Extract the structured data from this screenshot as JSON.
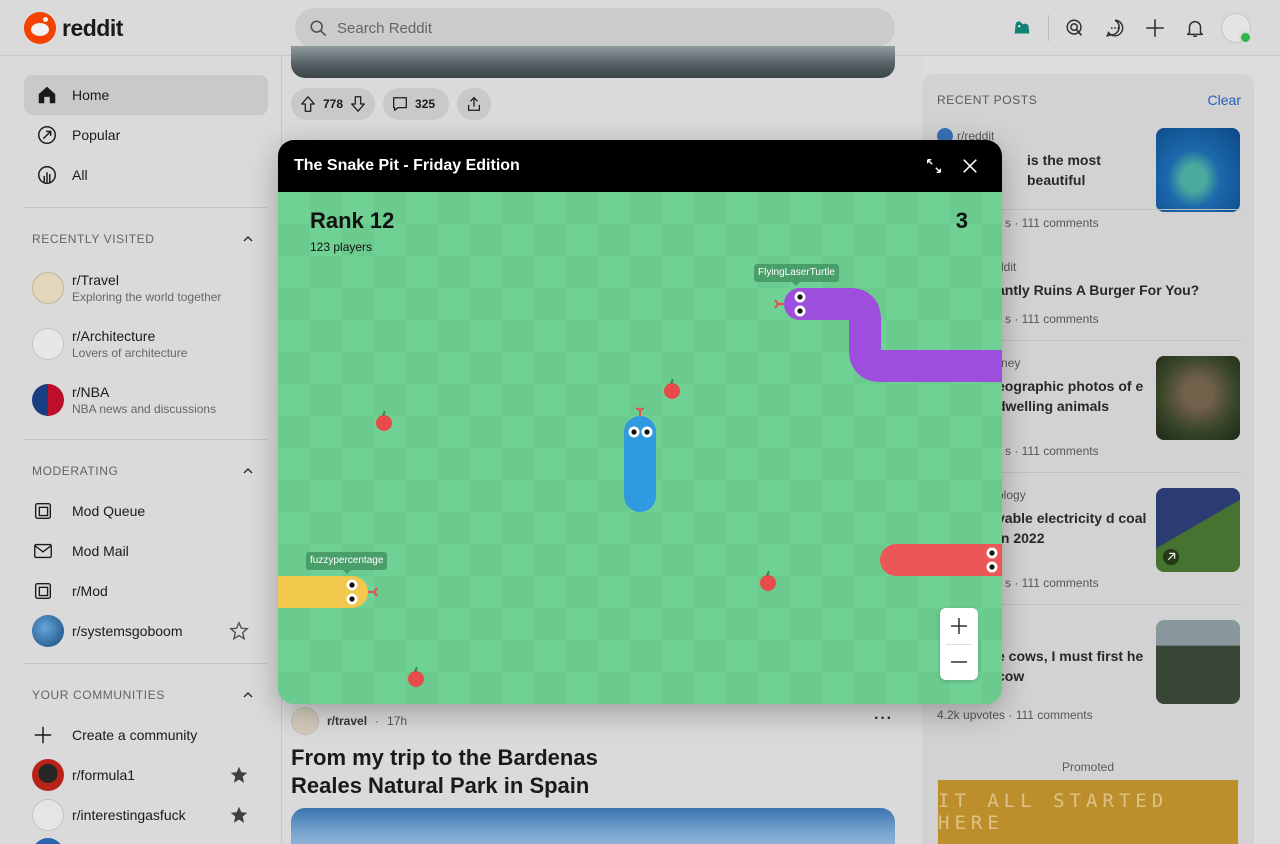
{
  "header": {
    "logo_text": "reddit",
    "search_placeholder": "Search Reddit",
    "icons": [
      "game-icon",
      "ads-icon",
      "chat-icon",
      "create-icon",
      "notifications-icon",
      "avatar"
    ]
  },
  "sidebar": {
    "nav": [
      {
        "label": "Home",
        "icon": "home-icon",
        "active": true
      },
      {
        "label": "Popular",
        "icon": "popular-icon"
      },
      {
        "label": "All",
        "icon": "all-icon"
      }
    ],
    "recently_visited_label": "RECENTLY VISITED",
    "recent": [
      {
        "name": "r/Travel",
        "desc": "Exploring the world together"
      },
      {
        "name": "r/Architecture",
        "desc": "Lovers of architecture"
      },
      {
        "name": "r/NBA",
        "desc": "NBA news and discussions"
      }
    ],
    "moderating_label": "MODERATING",
    "moderating": [
      {
        "label": "Mod Queue",
        "icon": "mod-queue-icon"
      },
      {
        "label": "Mod Mail",
        "icon": "mod-mail-icon"
      },
      {
        "label": "r/Mod",
        "icon": "mod-icon"
      },
      {
        "label": "r/systemsgoboom",
        "icon": "community-avatar"
      }
    ],
    "communities_label": "YOUR COMMUNITIES",
    "communities": [
      {
        "label": "Create a community"
      },
      {
        "label": "r/formula1"
      },
      {
        "label": "r/interestingasfuck"
      }
    ]
  },
  "feed": {
    "post1": {
      "upvotes": "778",
      "comments": "325"
    },
    "post2": {
      "subreddit": "r/travel",
      "time": "17h",
      "title": "From my trip to the Bardenas Reales Natural Park in Spain"
    }
  },
  "right": {
    "recent_posts_label": "RECENT POSTS",
    "clear_label": "Clear",
    "posts": [
      {
        "sub": "r/reddit",
        "title": "is the most beautiful",
        "stats": "s · 111 comments"
      },
      {
        "sub": "ddit",
        "title": "antly Ruins A Burger For You?",
        "stats": "s · 111 comments"
      },
      {
        "sub": "rney",
        "title": "eographic photos of e dwelling animals",
        "stats": "s · 111 comments"
      },
      {
        "sub": "ology",
        "title": "vable electricity d coal in 2022",
        "stats": "s · 111 comments"
      },
      {
        "sub": "",
        "title": "e cows, I must first he cow",
        "stats": "4.2k upvotes · 111 comments"
      }
    ],
    "promoted_label": "Promoted",
    "ad_text": "IT ALL STARTED HERE"
  },
  "game": {
    "title": "The Snake Pit - Friday Edition",
    "rank": "Rank 12",
    "players": "123 players",
    "score": "3",
    "snake_names": [
      "FlyingLaserTurtle",
      "fuzzypercentage"
    ],
    "colors": {
      "purple": "#9d4edd",
      "blue": "#2f9ae0",
      "yellow": "#f2c94c",
      "red": "#eb5757",
      "board": "#6fd193"
    }
  }
}
